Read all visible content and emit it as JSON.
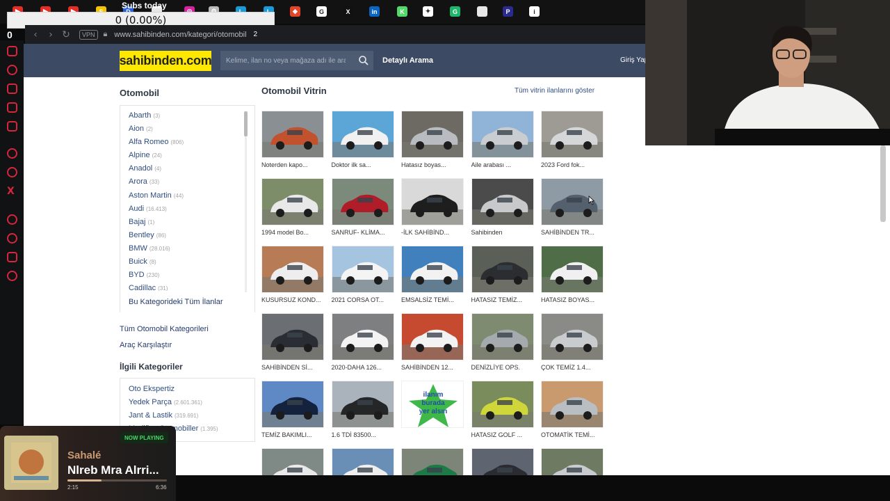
{
  "overlay": {
    "subs_title": "Subs today",
    "subs_progress": "0 (0.00%)",
    "subs_count": "0"
  },
  "browser": {
    "tab_icons": [
      {
        "name": "youtube-icon",
        "color": "#e52d27",
        "glyph": "▶"
      },
      {
        "name": "youtube-icon",
        "color": "#e52d27",
        "glyph": "▶"
      },
      {
        "name": "youtube-icon",
        "color": "#e52d27",
        "glyph": "▶"
      },
      {
        "name": "tab-active-icon",
        "color": "#f5c400",
        "glyph": "S"
      },
      {
        "name": "tab-icon",
        "color": "#2864d6",
        "glyph": "D"
      },
      {
        "name": "document-icon",
        "color": "#e7e7e7",
        "glyph": ""
      },
      {
        "name": "instagram-icon",
        "color": "#d6249f",
        "glyph": "◎"
      },
      {
        "name": "tab-icon",
        "color": "#bbbbbb",
        "glyph": "⚙"
      },
      {
        "name": "l-icon",
        "color": "#1a9ad6",
        "glyph": "L"
      },
      {
        "name": "l-icon",
        "color": "#1a9ad6",
        "glyph": "L"
      },
      {
        "name": "tab-icon",
        "color": "#e2452c",
        "glyph": "◆"
      },
      {
        "name": "google-icon",
        "color": "#ffffff",
        "glyph": "G"
      },
      {
        "name": "x-icon",
        "color": "#111111",
        "glyph": "X"
      },
      {
        "name": "linkedin-icon",
        "color": "#0a66c2",
        "glyph": "in"
      },
      {
        "name": "k-icon",
        "color": "#53d86a",
        "glyph": "K"
      },
      {
        "name": "tab-icon",
        "color": "#ffffff",
        "glyph": "✦"
      },
      {
        "name": "tab-icon",
        "color": "#1fb56a",
        "glyph": "G"
      },
      {
        "name": "document-icon",
        "color": "#e7e7e7",
        "glyph": ""
      },
      {
        "name": "p-icon",
        "color": "#2b2b8f",
        "glyph": "P"
      },
      {
        "name": "info-icon",
        "color": "#ffffff",
        "glyph": "i"
      }
    ],
    "vpn_label": "VPN",
    "url": "www.sahibinden.com/kategori/otomobil",
    "url_badge": "2"
  },
  "header": {
    "logo": "sahibinden.com",
    "search_placeholder": "Kelime, ilan no veya mağaza adı ile ara",
    "advanced_search": "Detaylı Arama",
    "login": "Giriş Yap"
  },
  "sidebar": {
    "title": "Otomobil",
    "categories": [
      {
        "label": "Abarth",
        "count": "(3)"
      },
      {
        "label": "Aion",
        "count": "(2)"
      },
      {
        "label": "Alfa Romeo",
        "count": "(806)"
      },
      {
        "label": "Alpine",
        "count": "(24)"
      },
      {
        "label": "Anadol",
        "count": "(4)"
      },
      {
        "label": "Arora",
        "count": "(33)"
      },
      {
        "label": "Aston Martin",
        "count": "(44)"
      },
      {
        "label": "Audi",
        "count": "(16.413)"
      },
      {
        "label": "Bajaj",
        "count": "(1)"
      },
      {
        "label": "Bentley",
        "count": "(86)"
      },
      {
        "label": "BMW",
        "count": "(28.016)"
      },
      {
        "label": "Buick",
        "count": "(8)"
      },
      {
        "label": "BYD",
        "count": "(230)"
      },
      {
        "label": "Cadillac",
        "count": "(31)"
      }
    ],
    "all_in_category": "Bu Kategorideki Tüm İlanlar",
    "all_categories": "Tüm Otomobil Kategorileri",
    "compare": "Araç Karşılaştır",
    "related_title": "İlgili Kategoriler",
    "related": [
      {
        "label": "Oto Ekspertiz",
        "count": ""
      },
      {
        "label": "Yedek Parça",
        "count": "(2.601.361)"
      },
      {
        "label": "Jant & Lastik",
        "count": "(319.691)"
      },
      {
        "label": "Modifiye Otomobiller",
        "count": "(1.395)"
      }
    ]
  },
  "main": {
    "title": "Otomobil Vitrin",
    "show_all": "Tüm vitrin ilanlarını göster",
    "listings": [
      {
        "caption": "Noterden kapo...",
        "car": "#c2522e",
        "bg": "#8a8f94"
      },
      {
        "caption": "Doktor ilk sa...",
        "car": "#f1f1f1",
        "bg": "#5ba6d6"
      },
      {
        "caption": "Hatasız boyas...",
        "car": "#b8bcc0",
        "bg": "#6d6a63"
      },
      {
        "caption": "Aile arabası ...",
        "car": "#c9ccd0",
        "bg": "#8fb4d8"
      },
      {
        "caption": "2023 Ford fok...",
        "car": "#d5d6d8",
        "bg": "#9d9b94"
      },
      {
        "caption": "1994 model Bo...",
        "car": "#e8e8e8",
        "bg": "#7d8d6a"
      },
      {
        "caption": "SANRUF- KLİMA...",
        "car": "#b01d28",
        "bg": "#7b8a7b"
      },
      {
        "caption": "-İLK SAHİBİND...",
        "car": "#1e1e1e",
        "bg": "#d9d9d9"
      },
      {
        "caption": "Sahibinden",
        "car": "#c8c9cb",
        "bg": "#4b4b4b"
      },
      {
        "caption": "SAHİBİNDEN TR...",
        "car": "#55606e",
        "bg": "#8e9aa4"
      },
      {
        "caption": "KUSURSUZ KOND...",
        "car": "#eeeeee",
        "bg": "#b77c55"
      },
      {
        "caption": "2021 CORSA OT...",
        "car": "#f4f4f4",
        "bg": "#a5c4e0"
      },
      {
        "caption": "EMSALSİZ TEMİ...",
        "car": "#f2f2f2",
        "bg": "#3f80bd"
      },
      {
        "caption": "HATASIZ TEMİZ...",
        "car": "#2b2d30",
        "bg": "#5a5f57"
      },
      {
        "caption": "HATASIZ BOYAS...",
        "car": "#f0f0f0",
        "bg": "#4f6e47"
      },
      {
        "caption": "SAHİBİNDEN Sİ...",
        "car": "#2a2d33",
        "bg": "#6b6e72"
      },
      {
        "caption": "2020-DAHA 126...",
        "car": "#f3f3f3",
        "bg": "#7d7f81"
      },
      {
        "caption": "SAHİBİNDEN 12...",
        "car": "#f2f2f2",
        "bg": "#c54a2f"
      },
      {
        "caption": "DENİZLİYE OPS.",
        "car": "#a5aaae",
        "bg": "#7e8b70"
      },
      {
        "caption": "ÇOK TEMİZ 1.4...",
        "car": "#c9cccf",
        "bg": "#8a8a86"
      },
      {
        "caption": "TEMİZ BAKIMLI...",
        "car": "#15223e",
        "bg": "#5f89c4"
      },
      {
        "caption": "1.6 TDİ 83500...",
        "car": "#252627",
        "bg": "#aab3bc"
      },
      {
        "caption": "",
        "car": "",
        "bg": "#ffffff",
        "ad": true,
        "ad_lines": [
          "ilanım",
          "burada",
          "yer alsın"
        ]
      },
      {
        "caption": "HATASIZ GOLF ...",
        "car": "#cfd63a",
        "bg": "#7a8c5c"
      },
      {
        "caption": "OTOMATİK TEMİ...",
        "car": "#b9bec2",
        "bg": "#c89a6e"
      },
      {
        "caption": "",
        "car": "#e9e9e9",
        "bg": "#7f8a86"
      },
      {
        "caption": "",
        "car": "#eeeeee",
        "bg": "#6a8fb6"
      },
      {
        "caption": "",
        "car": "#1b7a45",
        "bg": "#7d8478"
      },
      {
        "caption": "",
        "car": "#2a2c31",
        "bg": "#5e6570"
      },
      {
        "caption": "",
        "car": "#c8cbcf",
        "bg": "#6f7a63"
      }
    ]
  },
  "now_playing": {
    "badge": "NOW PLAYING",
    "artist": "Sahalé",
    "title": "Nlreb Mra Alrri...",
    "elapsed": "2:15",
    "duration": "6:36",
    "progress": 0.34
  }
}
